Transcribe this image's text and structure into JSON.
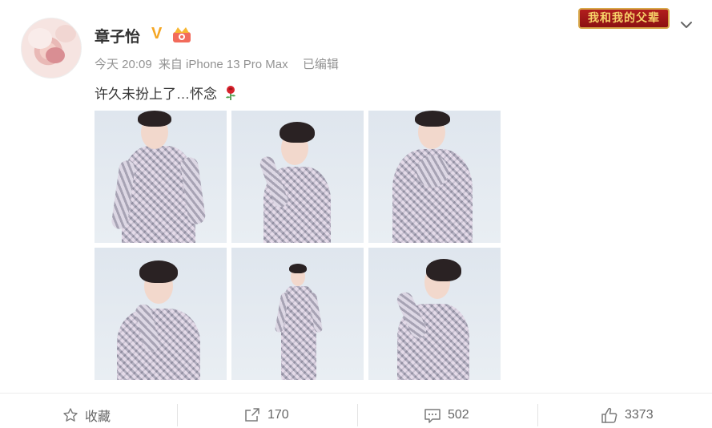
{
  "post": {
    "username": "章子怡",
    "verified_mark": "V",
    "timestamp": "今天 20:09",
    "source": "来自 iPhone 13 Pro Max",
    "edited": "已编辑",
    "text": "许久未扮上了…怀念"
  },
  "header": {
    "brand_badge": "我和我的父辈",
    "menu_icon": "chevron-down-icon"
  },
  "photos": [
    {
      "pose": "standing-hands-on-hip"
    },
    {
      "pose": "profile-hand-to-chin"
    },
    {
      "pose": "hands-clasped"
    },
    {
      "pose": "hand-to-collar"
    },
    {
      "pose": "full-length"
    },
    {
      "pose": "side-profile-hand-to-lips"
    }
  ],
  "actions": {
    "favorite_label": "收藏",
    "repost_count": "170",
    "comment_count": "502",
    "like_count": "3373"
  },
  "colors": {
    "verified": "#f5a623",
    "meta_text": "#939393",
    "action_text": "#666666",
    "divider": "#ececec"
  }
}
